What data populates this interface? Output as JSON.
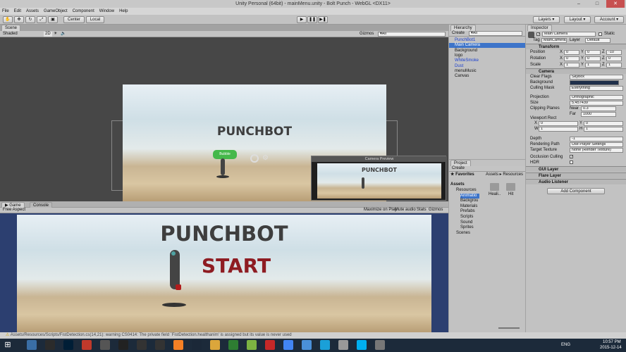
{
  "window": {
    "title": "Unity Personal (64bit) - mainMenu.unity - Bolt Punch - WebGL <DX11>"
  },
  "menu": [
    "File",
    "Edit",
    "Assets",
    "GameObject",
    "Component",
    "Window",
    "Help"
  ],
  "toolbar": {
    "pivot": "Center",
    "space": "Local",
    "layers": "Layers",
    "layout": "Layout",
    "account": "Account"
  },
  "scene": {
    "tab": "Scene",
    "shading": "Shaded",
    "mode2d": "2D",
    "gizmos": "Gizmos",
    "search": "▾All",
    "title": "PUNCHBOT",
    "preview_title": "Camera Preview",
    "preview_game_title": "PUNCHBOT",
    "bubble": "Bubble"
  },
  "game": {
    "tab": "Game",
    "console_tab": "Console",
    "aspect": "Free Aspect",
    "maximize": "Maximize on Play",
    "mute": "Mute audio",
    "stats": "Stats",
    "gizmos": "Gizmos",
    "title": "PUNCHBOT",
    "start": "START"
  },
  "hierarchy": {
    "tab": "Hierarchy",
    "create": "Create",
    "search": "▾All",
    "items": [
      {
        "label": "PunchBot1",
        "color": "#1a3fd0"
      },
      {
        "label": "Main Camera",
        "color": "#ffffff"
      },
      {
        "label": "Background",
        "color": "#111111"
      },
      {
        "label": "logo",
        "color": "#111111"
      },
      {
        "label": "WhiteSmoke",
        "color": "#1a3fd0"
      },
      {
        "label": "Dust",
        "color": "#1a3fd0"
      },
      {
        "label": "menuMusic",
        "color": "#111111"
      },
      {
        "label": "Canvas",
        "color": "#111111"
      }
    ]
  },
  "project": {
    "tab": "Project",
    "create": "Create",
    "favorites": "Favorites",
    "breadcrumb": "Assets ▸ Resources",
    "assets": "Assets",
    "tree": [
      "Resources",
      "Animatio",
      "Backgrou",
      "Materials",
      "Prefabs",
      "Scripts",
      "Sound",
      "Sprites",
      "Scenes"
    ],
    "folders": [
      "Heali..",
      "Hit"
    ]
  },
  "inspector": {
    "tab": "Inspector",
    "object_name": "Main Camera",
    "static": "Static",
    "tag_label": "Tag",
    "tag": "MainCamera",
    "layer_label": "Layer",
    "layer": "Default",
    "transform": {
      "title": "Transform",
      "position": "Position",
      "rotation": "Rotation",
      "scale": "Scale",
      "x": "X",
      "y": "Y",
      "z": "Z",
      "pos": [
        "0",
        "0",
        "-10"
      ],
      "rot": [
        "0",
        "0",
        "0"
      ],
      "scl": [
        "1",
        "1",
        "1"
      ]
    },
    "camera": {
      "title": "Camera",
      "clear_flags": "Clear Flags",
      "clear_flags_value": "Skybox",
      "background": "Background",
      "culling_mask": "Culling Mask",
      "culling_mask_value": "Everything",
      "projection": "Projection",
      "projection_value": "Orthographic",
      "size": "Size",
      "size_value": "5.457439",
      "clipping": "Clipping Planes",
      "near": "Near",
      "near_value": "0.3",
      "far": "Far",
      "far_value": "1000",
      "viewport": "Viewport Rect",
      "vx": "0",
      "vy": "0",
      "w_label": "W",
      "vw": "1",
      "h_label": "H",
      "vh": "1",
      "depth": "Depth",
      "depth_value": "-1",
      "rendering_path": "Rendering Path",
      "rendering_path_value": "Use Player Settings",
      "target_texture": "Target Texture",
      "target_texture_value": "None (Render Texture)",
      "occlusion": "Occlusion Culling",
      "hdr": "HDR"
    },
    "components": [
      "GUI Layer",
      "Flare Layer",
      "Audio Listener"
    ],
    "add_component": "Add Component"
  },
  "status": "Assets/Resources/Scripts/FistDetection.cs(14,21): warning CS0414: The private field `FistDetection.healthanim' is assigned but its value is never used",
  "clock": {
    "time": "10:57 PM",
    "date": "2015-12-14",
    "lang": "ENG"
  }
}
